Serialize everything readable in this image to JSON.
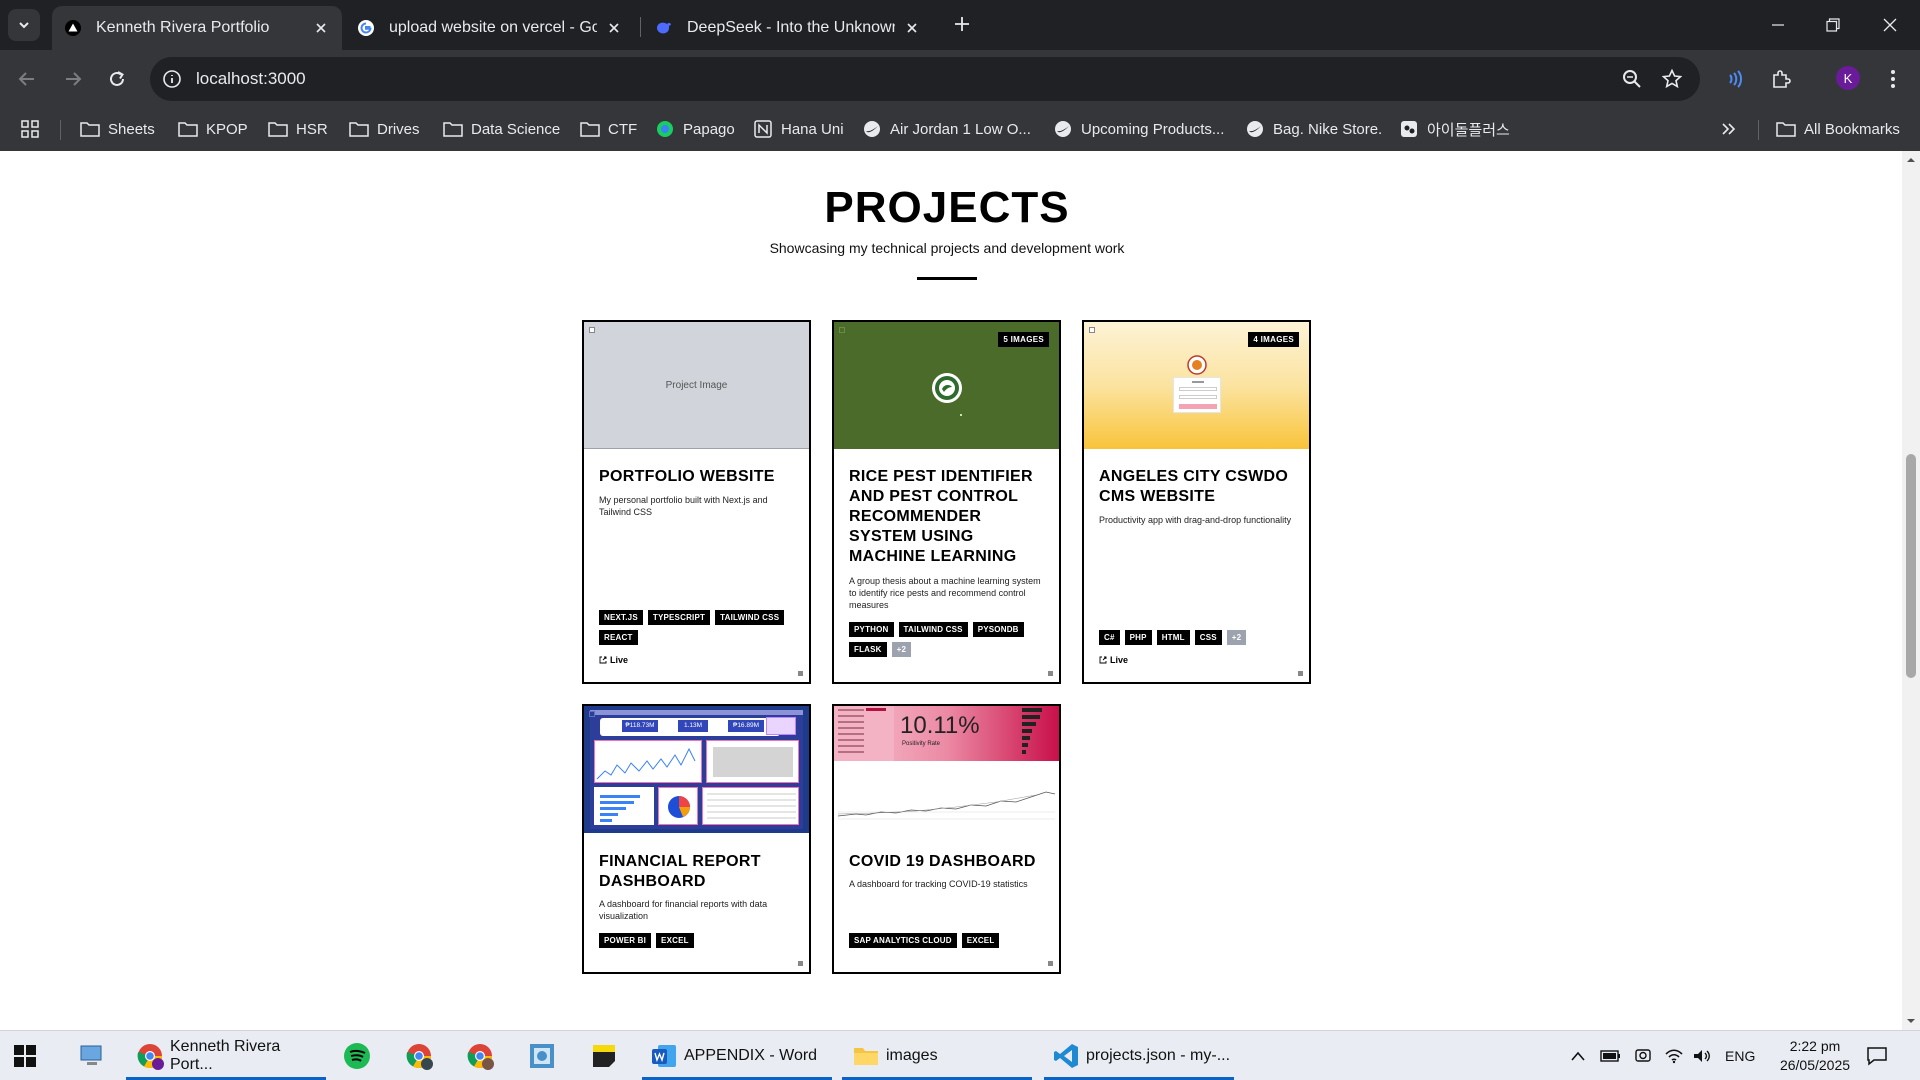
{
  "browser": {
    "tabs": [
      {
        "title": "Kenneth Rivera Portfolio",
        "active": true,
        "favicon": "vercel-triangle-icon"
      },
      {
        "title": "upload website on vercel - Goo",
        "active": false,
        "favicon": "google-icon"
      },
      {
        "title": "DeepSeek - Into the Unknown",
        "active": false,
        "favicon": "deepseek-icon"
      }
    ],
    "url": "localhost:3000",
    "profile_initial": "K",
    "bookmarks": [
      {
        "label": "Sheets",
        "icon": "folder-icon"
      },
      {
        "label": "KPOP",
        "icon": "folder-icon"
      },
      {
        "label": "HSR",
        "icon": "folder-icon"
      },
      {
        "label": "Drives",
        "icon": "folder-icon"
      },
      {
        "label": "Data Science",
        "icon": "folder-icon"
      },
      {
        "label": "CTF",
        "icon": "folder-icon"
      },
      {
        "label": "Papago",
        "icon": "papago-icon"
      },
      {
        "label": "Hana Uni",
        "icon": "notion-icon"
      },
      {
        "label": "Air Jordan 1 Low O...",
        "icon": "nike-icon"
      },
      {
        "label": "Upcoming Products...",
        "icon": "nike-icon"
      },
      {
        "label": "Bag. Nike Store.",
        "icon": "nike-icon"
      },
      {
        "label": "아이돌플러스",
        "icon": "idolplus-icon"
      }
    ],
    "all_bookmarks": "All Bookmarks"
  },
  "section": {
    "title": "PROJECTS",
    "subtitle": "Showcasing my technical projects and development work"
  },
  "projects": [
    {
      "title": "PORTFOLIO WEBSITE",
      "description": "My personal portfolio built with Next.js and Tailwind CSS",
      "image_placeholder": "Project Image",
      "image_count": "",
      "tags": [
        "NEXT.JS",
        "TYPESCRIPT",
        "TAILWIND CSS",
        "REACT"
      ],
      "more": "",
      "live": "Live"
    },
    {
      "title": "RICE PEST IDENTIFIER AND PEST CONTROL RECOMMENDER SYSTEM USING MACHINE LEARNING",
      "description": "A group thesis about a machine learning system to identify rice pests and recommend control measures",
      "image_count": "5 IMAGES",
      "tags": [
        "PYTHON",
        "TAILWIND CSS",
        "PYSONDB",
        "FLASK"
      ],
      "more": "+2",
      "live": ""
    },
    {
      "title": "ANGELES CITY CSWDO CMS WEBSITE",
      "description": "Productivity app with drag-and-drop functionality",
      "image_count": "4 IMAGES",
      "tags": [
        "C#",
        "PHP",
        "HTML",
        "CSS"
      ],
      "more": "+2",
      "live": "Live"
    },
    {
      "title": "FINANCIAL REPORT DASHBOARD",
      "description": "A dashboard for financial reports with data visualization",
      "image_count": "",
      "tags": [
        "POWER BI",
        "EXCEL"
      ],
      "more": "",
      "live": "",
      "kpis": [
        "₱118.73M",
        "1.13M",
        "₱16.89M"
      ]
    },
    {
      "title": "COVID 19 DASHBOARD",
      "description": "A dashboard for tracking COVID-19 statistics",
      "image_count": "",
      "tags": [
        "SAP ANALYTICS CLOUD",
        "EXCEL"
      ],
      "more": "",
      "live": "",
      "kpi": "10.11%",
      "kpi_label": "Positivity Rate"
    }
  ],
  "taskbar": {
    "items": [
      {
        "label": "Kenneth Rivera Port...",
        "icon": "chrome-icon"
      },
      {
        "label": "",
        "icon": "spotify-icon"
      },
      {
        "label": "",
        "icon": "chrome-icon"
      },
      {
        "label": "",
        "icon": "chrome-icon"
      },
      {
        "label": "",
        "icon": "photos-icon"
      },
      {
        "label": "",
        "icon": "sticky-notes-icon"
      },
      {
        "label": "APPENDIX - Word",
        "icon": "word-icon"
      },
      {
        "label": "images",
        "icon": "folder-icon"
      },
      {
        "label": "projects.json - my-...",
        "icon": "vscode-icon"
      }
    ],
    "language": "ENG",
    "time": "2:22 pm",
    "date": "26/05/2025"
  },
  "colors": {
    "chrome_dark": "#202124",
    "chrome_toolbar": "#35363a",
    "rice_thumb": "#4a6b2a",
    "cms_thumb_top": "#fdf3d6",
    "cms_thumb_bottom": "#f9c43a",
    "placeholder_thumb": "#d1d5db",
    "covid_pink": "#e8476f"
  }
}
